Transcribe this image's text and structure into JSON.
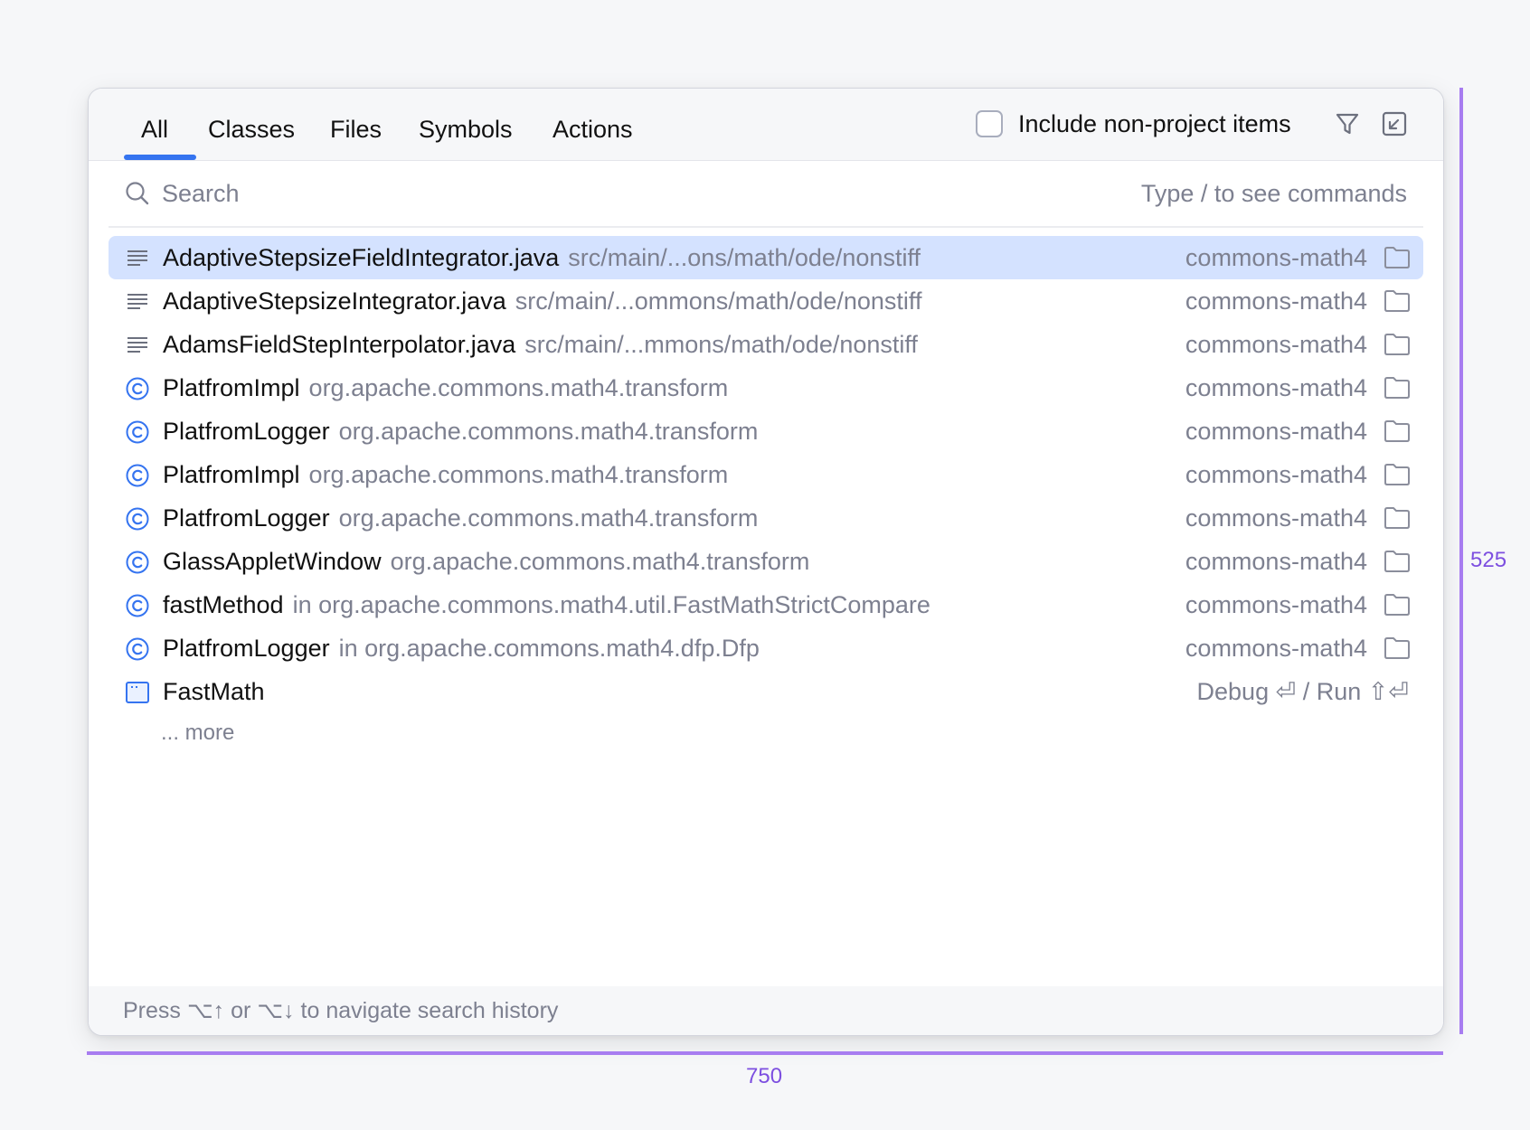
{
  "tabs": [
    {
      "label": "All",
      "active": true
    },
    {
      "label": "Classes",
      "active": false
    },
    {
      "label": "Files",
      "active": false
    },
    {
      "label": "Symbols",
      "active": false
    },
    {
      "label": "Actions",
      "active": false
    }
  ],
  "options": {
    "include_non_project_label": "Include non-project items",
    "include_non_project_checked": false,
    "filter_icon": "filter-icon",
    "collapse_icon": "open-in-window-icon"
  },
  "search": {
    "placeholder": "Search",
    "value": "",
    "hint": "Type / to see commands"
  },
  "results": [
    {
      "icon": "file-text-icon",
      "name": "AdaptiveStepsizeFieldIntegrator.java",
      "location": "src/main/...ons/math/ode/nonstiff",
      "project": "commons-math4",
      "selected": true
    },
    {
      "icon": "file-text-icon",
      "name": "AdaptiveStepsizeIntegrator.java",
      "location": "src/main/...ommons/math/ode/nonstiff",
      "project": "commons-math4",
      "selected": false
    },
    {
      "icon": "file-text-icon",
      "name": "AdamsFieldStepInterpolator.java",
      "location": "src/main/...mmons/math/ode/nonstiff",
      "project": "commons-math4",
      "selected": false
    },
    {
      "icon": "class-icon",
      "name": "PlatfromImpl",
      "location": "org.apache.commons.math4.transform",
      "project": "commons-math4",
      "selected": false
    },
    {
      "icon": "class-icon",
      "name": "PlatfromLogger",
      "location": "org.apache.commons.math4.transform",
      "project": "commons-math4",
      "selected": false
    },
    {
      "icon": "class-icon",
      "name": "PlatfromImpl",
      "location": "org.apache.commons.math4.transform",
      "project": "commons-math4",
      "selected": false
    },
    {
      "icon": "class-icon",
      "name": "PlatfromLogger",
      "location": "org.apache.commons.math4.transform",
      "project": "commons-math4",
      "selected": false
    },
    {
      "icon": "class-icon",
      "name": "GlassAppletWindow",
      "location": "org.apache.commons.math4.transform",
      "project": "commons-math4",
      "selected": false
    },
    {
      "icon": "class-icon",
      "name": "fastMethod",
      "location": "in org.apache.commons.math4.util.FastMathStrictCompare",
      "project": "commons-math4",
      "selected": false
    },
    {
      "icon": "class-icon",
      "name": "PlatfromLogger",
      "location": "in org.apache.commons.math4.dfp.Dfp",
      "project": "commons-math4",
      "selected": false
    }
  ],
  "run_config": {
    "icon": "run-configuration-icon",
    "name": "FastMath",
    "shortcut": "Debug ⏎ / Run ⇧⏎"
  },
  "more_label": "... more",
  "footer": {
    "text": "Press ⌥↑ or ⌥↓ to navigate search history"
  },
  "annotations": {
    "width_label": "750",
    "height_label": "525"
  },
  "colors": {
    "accent": "#3574f0",
    "selection": "#d4e2ff",
    "muted_text": "#7d8090",
    "measure": "#a77cf0"
  }
}
